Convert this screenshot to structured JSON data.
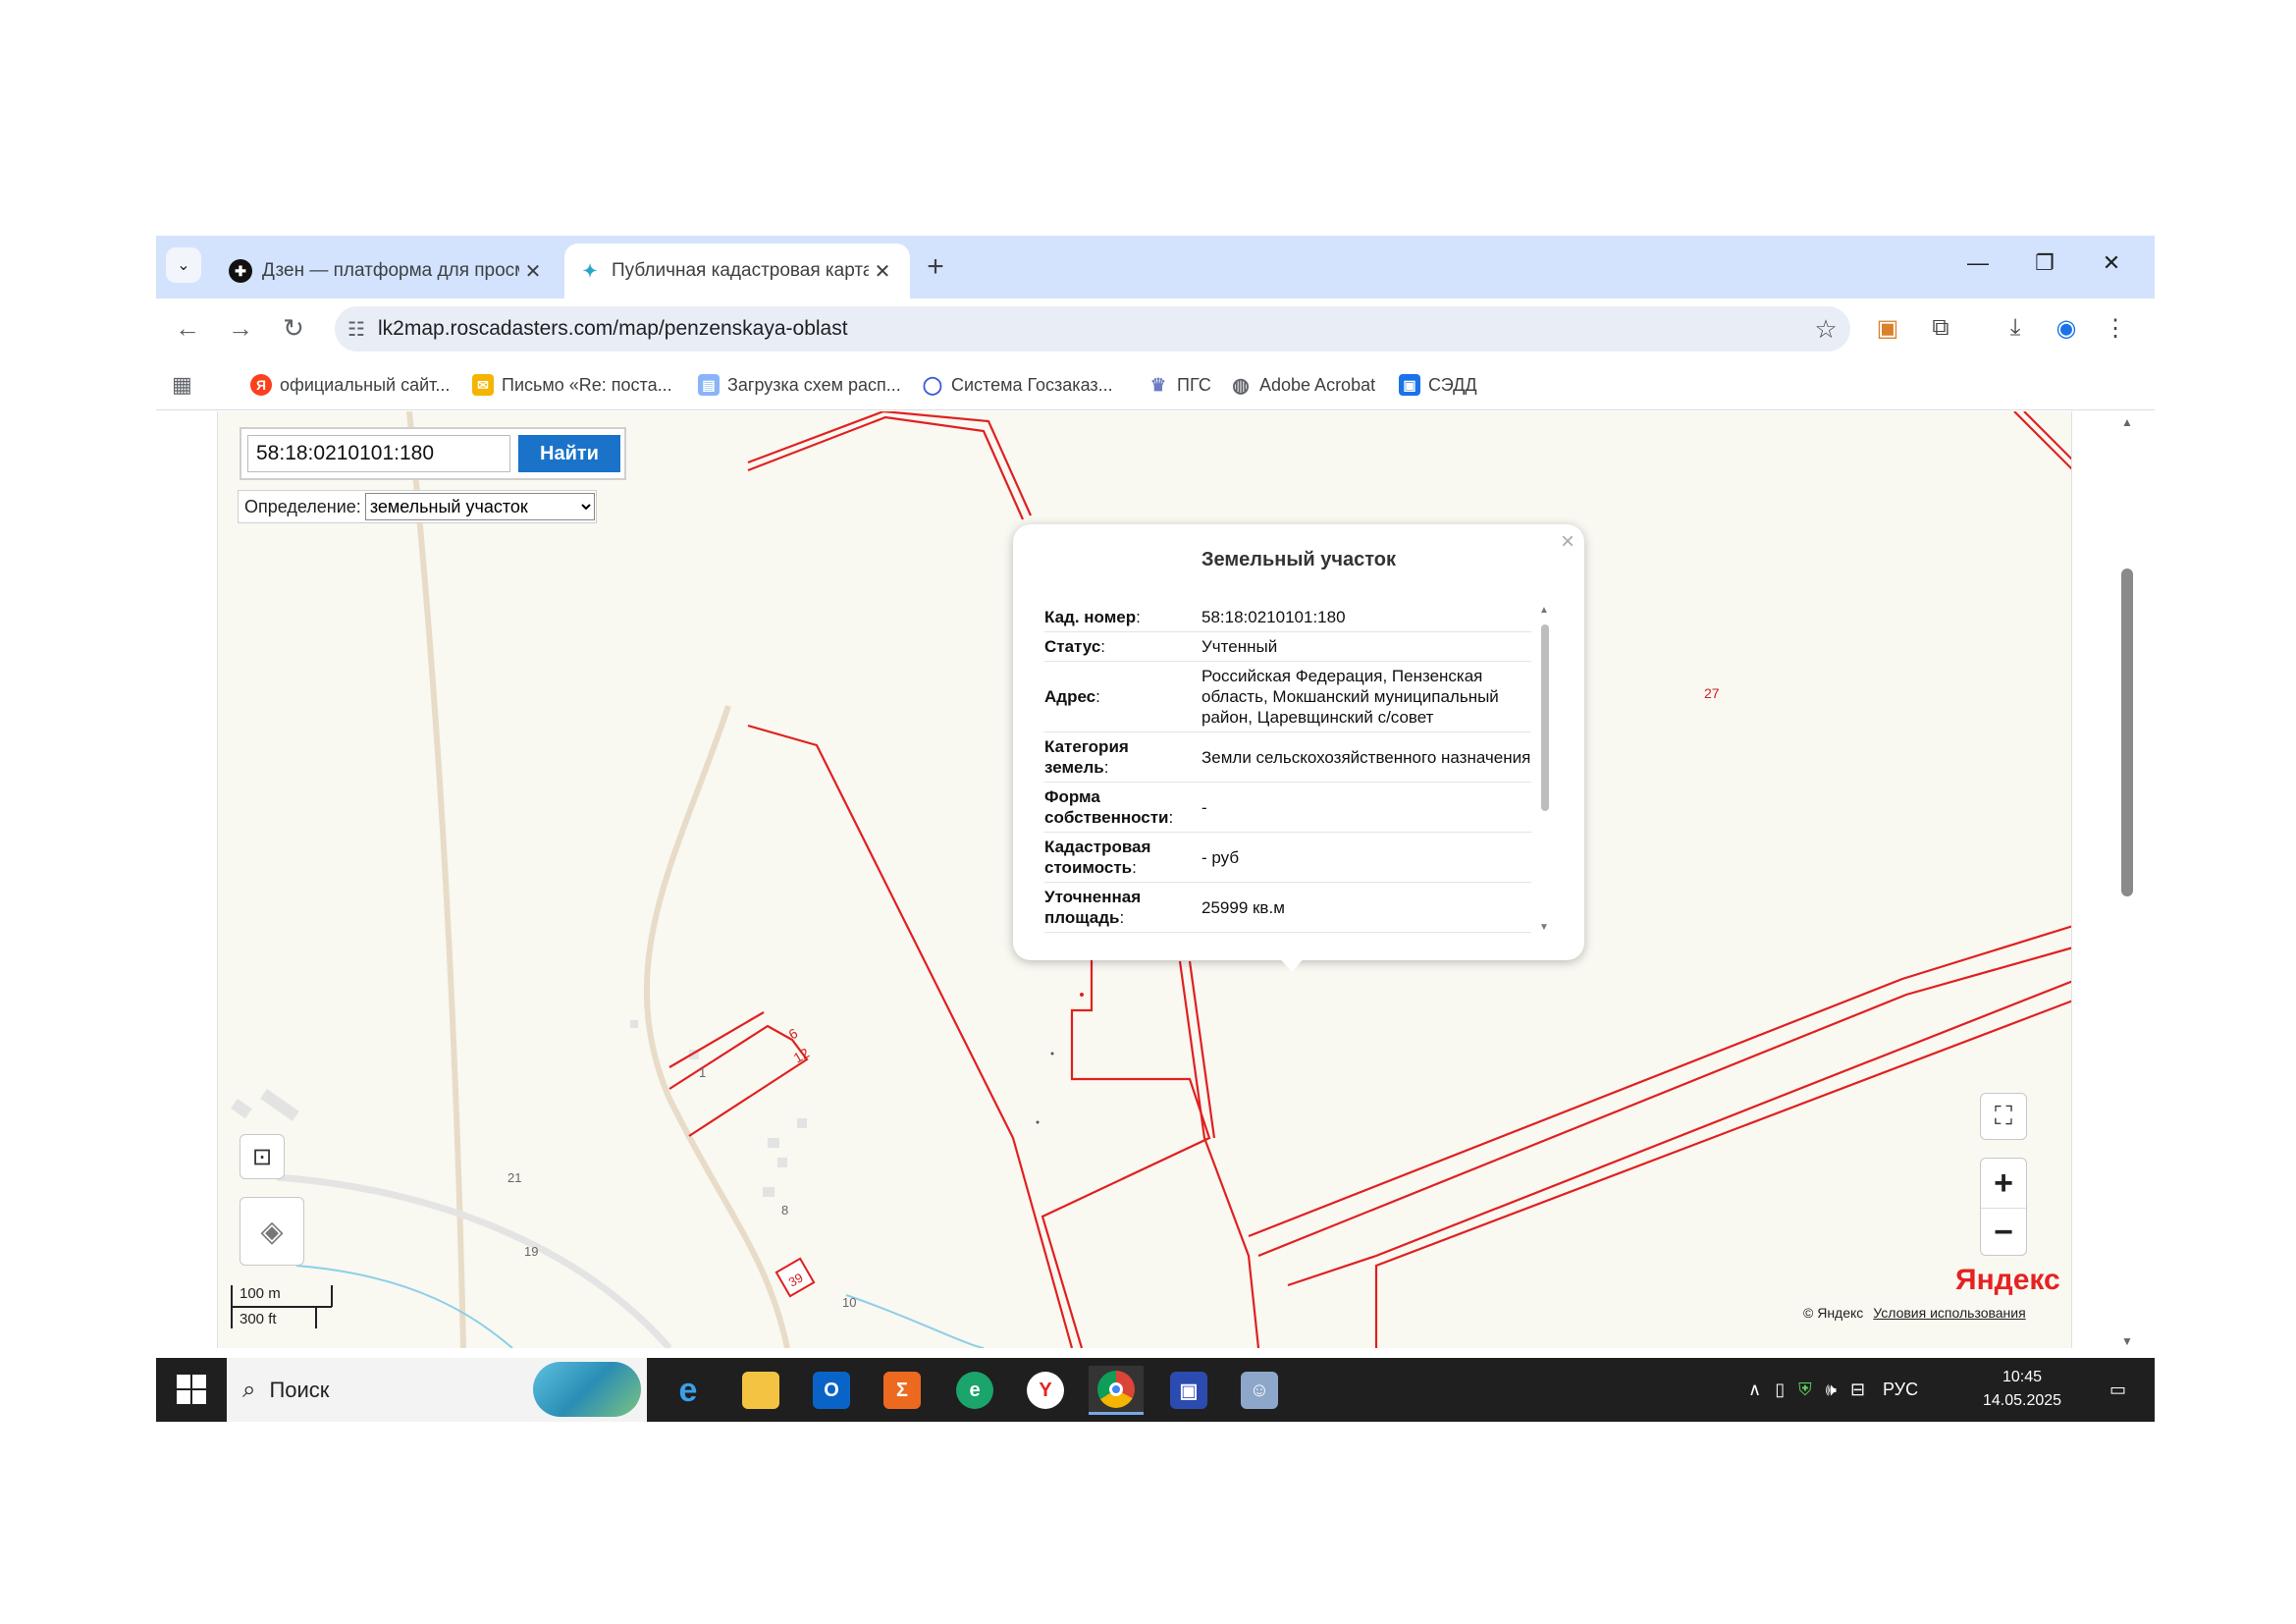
{
  "browser": {
    "tabs": [
      {
        "label": "Дзен — платформа для просм",
        "favicon": "dzen-icon"
      },
      {
        "label": "Публичная кадастровая карта",
        "favicon": "cadastre-icon",
        "active": true
      }
    ],
    "url": "lk2map.roscadasters.com/map/penzenskaya-oblast"
  },
  "bookmarks": [
    {
      "label": "официальный сайт...",
      "icon": "yandex-icon",
      "color": "#fc3f1d",
      "glyph": "Я"
    },
    {
      "label": "Письмо «Re: поста...",
      "icon": "mail-icon",
      "color": "#f4b400",
      "glyph": "✉"
    },
    {
      "label": "Загрузка схем расп...",
      "icon": "document-icon",
      "color": "#8ab4f8",
      "glyph": "▤"
    },
    {
      "label": "Система Госзаказ...",
      "icon": "circle-icon",
      "color": "#3b5bdb",
      "glyph": "○"
    },
    {
      "label": "ПГС",
      "icon": "emblem-icon",
      "color": "#6b7cc2",
      "glyph": "♛"
    },
    {
      "label": "Adobe Acrobat",
      "icon": "globe-icon",
      "color": "#5f6368",
      "glyph": "◍"
    },
    {
      "label": "СЭДД",
      "icon": "briefcase-icon",
      "color": "#1a73e8",
      "glyph": "▣"
    }
  ],
  "search": {
    "value": "58:18:0210101:180",
    "button": "Найти",
    "definition_label": "Определение:",
    "definition_value": "земельный участок"
  },
  "popup": {
    "title": "Земельный участок",
    "close": "×",
    "rows": [
      {
        "label": "Кад. номер",
        "value": "58:18:0210101:180"
      },
      {
        "label": "Статус",
        "value": "Учтенный"
      },
      {
        "label": "Адрес",
        "value": "Российская Федерация, Пензенская область, Мокшанский муниципальный район, Царевщинский с/совет"
      },
      {
        "label": "Категория земель",
        "value": "Земли сельскохозяйственного назначения"
      },
      {
        "label": "Форма собственности",
        "value": "-"
      },
      {
        "label": "Кадастровая стоимость",
        "value": "- руб"
      },
      {
        "label": "Уточненная площадь",
        "value": "25999 кв.м"
      }
    ]
  },
  "map": {
    "labels": [
      "27",
      "6",
      "12",
      "1",
      "21",
      "8",
      "19",
      "39",
      "10"
    ],
    "scale_m": "100 m",
    "scale_ft": "300 ft",
    "brand": "Яндекс",
    "copyright": "© Яндекс",
    "terms": "Условия использования"
  },
  "taskbar": {
    "search_placeholder": "Поиск",
    "lang": "РУС",
    "time": "10:45",
    "date": "14.05.2025"
  }
}
